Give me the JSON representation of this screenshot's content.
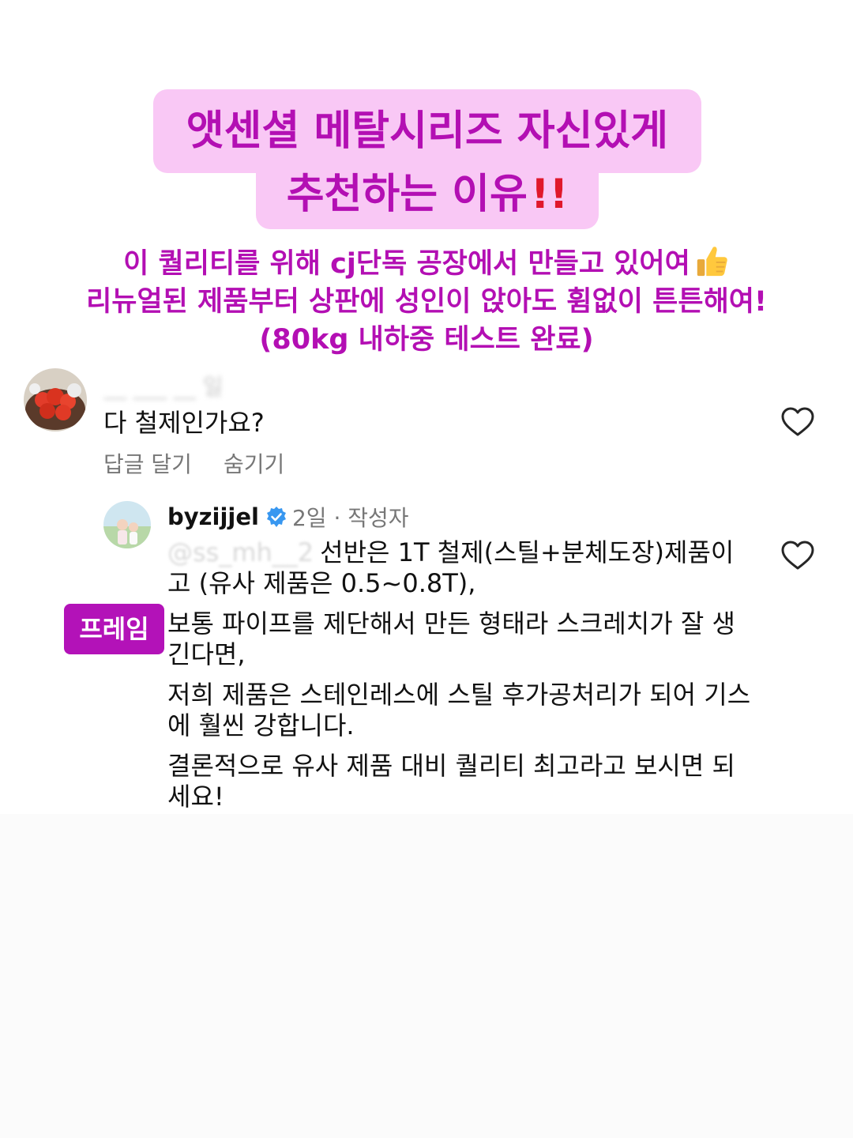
{
  "headline": {
    "line1": "앳센셜 메탈시리즈 자신있게",
    "line2": "추천하는 이유",
    "line2_emphasis": "!!"
  },
  "subtitle": {
    "line1": "이 퀄리티를 위해 cj단독 공장에서 만들고 있어여",
    "line2": "리뉴얼된 제품부터 상판에 성인이 앉아도 휨없이 튼튼해여!",
    "line3": "(80kg 내하중 테스트 완료)"
  },
  "comment": {
    "username_blurred": "__ ___ __ 일",
    "text": "다 철제인가요?",
    "reply_action": "답글 달기",
    "hide_action": "숨기기"
  },
  "reply": {
    "author": "byzijjel",
    "meta": "2일 · 작성자",
    "mention": "@ss_mh__2",
    "paragraphs": [
      "선반은 1T 철제(스틸+분체도장)제품이고 (유사 제품은 0.5~0.8T),",
      "보통 파이프를 제단해서 만든 형태라 스크레치가 잘 생긴다면,",
      "저희 제품은 스테인레스에 스틸 후가공처리가 되어 기스에 훨씬 강합니다.",
      "결론적으로 유사 제품 대비 퀄리티 최고라고 보시면 되세요!"
    ]
  },
  "badge": {
    "label": "프레임"
  },
  "colors": {
    "headline_bg": "#f9c8f5",
    "headline_text": "#b30fb3",
    "badge_bg": "#b312b8",
    "verified": "#3897f0",
    "emphasis": "#e0182b"
  },
  "icons": [
    "thumbs-up-icon",
    "heart-icon",
    "verified-badge-icon"
  ]
}
